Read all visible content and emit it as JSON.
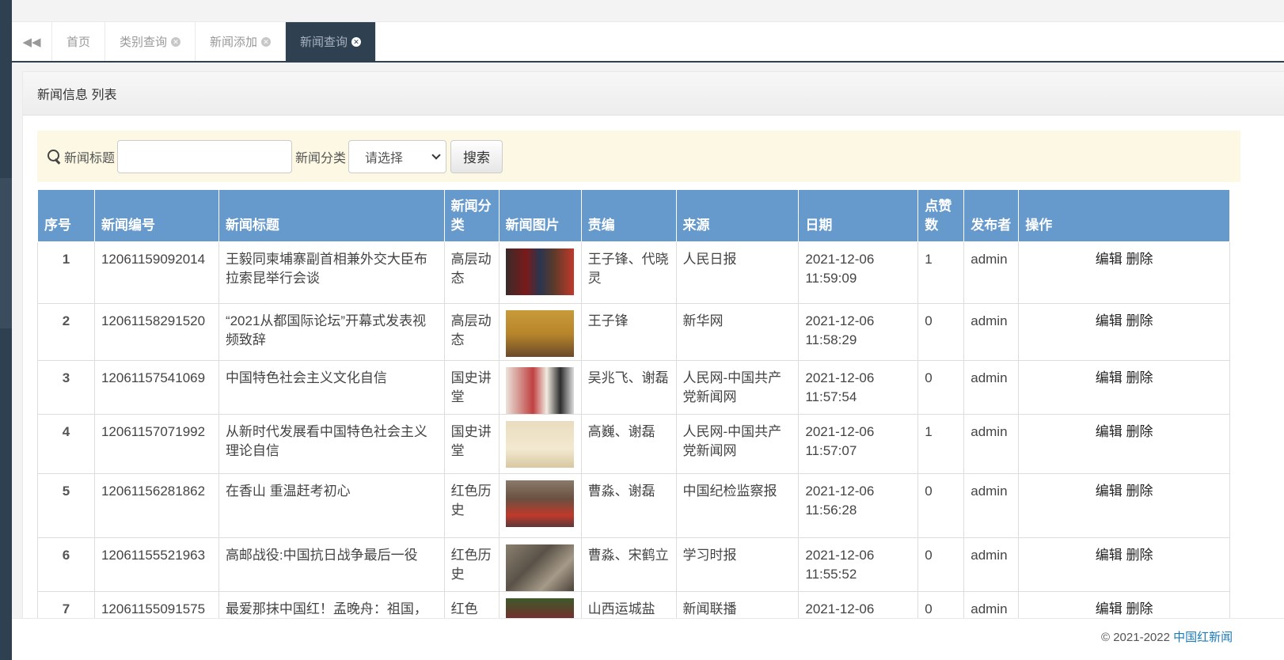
{
  "tabs": {
    "items": [
      {
        "label": "首页",
        "closable": false,
        "active": false
      },
      {
        "label": "类别查询",
        "closable": true,
        "active": false
      },
      {
        "label": "新闻添加",
        "closable": true,
        "active": false
      },
      {
        "label": "新闻查询",
        "closable": true,
        "active": true
      }
    ]
  },
  "panel": {
    "title": "新闻信息 列表"
  },
  "search": {
    "title_label": "新闻标题",
    "title_value": "",
    "category_label": "新闻分类",
    "category_selected": "请选择",
    "button_label": "搜索"
  },
  "table": {
    "headers": [
      "序号",
      "新闻编号",
      "新闻标题",
      "新闻分类",
      "新闻图片",
      "责编",
      "来源",
      "日期",
      "点赞数",
      "发布者",
      "操作"
    ],
    "rows": [
      {
        "no": "1",
        "id": "12061159092014",
        "title": "王毅同柬埔寨副首相兼外交大臣布拉索昆举行会谈",
        "category": "高层动态",
        "editor": "王子锋、代晓灵",
        "source": "人民日报",
        "date": "2021-12-06 11:59:09",
        "likes": "1",
        "publisher": "admin"
      },
      {
        "no": "2",
        "id": "12061158291520",
        "title": "“2021从都国际论坛”开幕式发表视频致辞",
        "category": "高层动态",
        "editor": "王子锋",
        "source": "新华网",
        "date": "2021-12-06 11:58:29",
        "likes": "0",
        "publisher": "admin"
      },
      {
        "no": "3",
        "id": "12061157541069",
        "title": "中国特色社会主义文化自信",
        "category": "国史讲堂",
        "editor": "吴兆飞、谢磊",
        "source": "人民网-中国共产党新闻网",
        "date": "2021-12-06 11:57:54",
        "likes": "0",
        "publisher": "admin"
      },
      {
        "no": "4",
        "id": "12061157071992",
        "title": "从新时代发展看中国特色社会主义理论自信",
        "category": "国史讲堂",
        "editor": "高巍、谢磊",
        "source": "人民网-中国共产党新闻网",
        "date": "2021-12-06 11:57:07",
        "likes": "1",
        "publisher": "admin"
      },
      {
        "no": "5",
        "id": "12061156281862",
        "title": "在香山 重温赶考初心",
        "category": "红色历史",
        "editor": "曹淼、谢磊",
        "source": "中国纪检监察报",
        "date": "2021-12-06 11:56:28",
        "likes": "0",
        "publisher": "admin"
      },
      {
        "no": "6",
        "id": "12061155521963",
        "title": "高邮战役:中国抗日战争最后一役",
        "category": "红色历史",
        "editor": "曹淼、宋鹤立",
        "source": "学习时报",
        "date": "2021-12-06 11:55:52",
        "likes": "0",
        "publisher": "admin"
      },
      {
        "no": "7",
        "id": "12061155091575",
        "title": "最爱那抹中国红！孟晚舟：祖国，",
        "category": "红色",
        "editor": "山西运城盐",
        "source": "新闻联播",
        "date": "2021-12-06",
        "likes": "0",
        "publisher": "admin"
      }
    ],
    "edit_label": "编辑",
    "delete_label": "删除"
  },
  "footer": {
    "copyright": "© 2021-2022 ",
    "link_text": "中国红新闻"
  },
  "colors": {
    "header_bg": "#6699cc",
    "sidebar": "#2f4050",
    "search_bg": "#fcf8e3"
  }
}
